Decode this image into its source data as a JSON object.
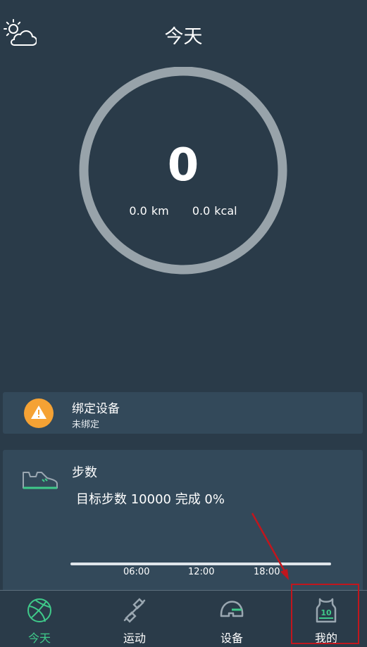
{
  "header": {
    "title": "今天",
    "weather_icon": "weather-partly-cloudy-icon"
  },
  "summary": {
    "steps": "0",
    "distance_value": "0.0",
    "distance_unit": "km",
    "calorie_value": "0.0",
    "calorie_unit": "kcal",
    "ring_color": "#98a3aa"
  },
  "bind_card": {
    "icon": "warning-icon",
    "title": "绑定设备",
    "subtitle": "未绑定",
    "icon_color": "#f5a234"
  },
  "steps_card": {
    "icon": "shoe-icon",
    "title": "步数",
    "goal_text": "目标步数 10000 完成 0%",
    "timeline_ticks": [
      "06:00",
      "12:00",
      "18:00"
    ]
  },
  "tabs": [
    {
      "label": "今天",
      "icon": "basketball-icon",
      "active": true
    },
    {
      "label": "运动",
      "icon": "dumbbell-icon",
      "active": false
    },
    {
      "label": "设备",
      "icon": "helmet-icon",
      "active": false
    },
    {
      "label": "我的",
      "icon": "jersey-icon",
      "badge": "10",
      "active": false
    }
  ],
  "colors": {
    "background": "#2a3b49",
    "card": "#33495a",
    "accent": "#3fca8a",
    "annotation": "#c1161d"
  }
}
